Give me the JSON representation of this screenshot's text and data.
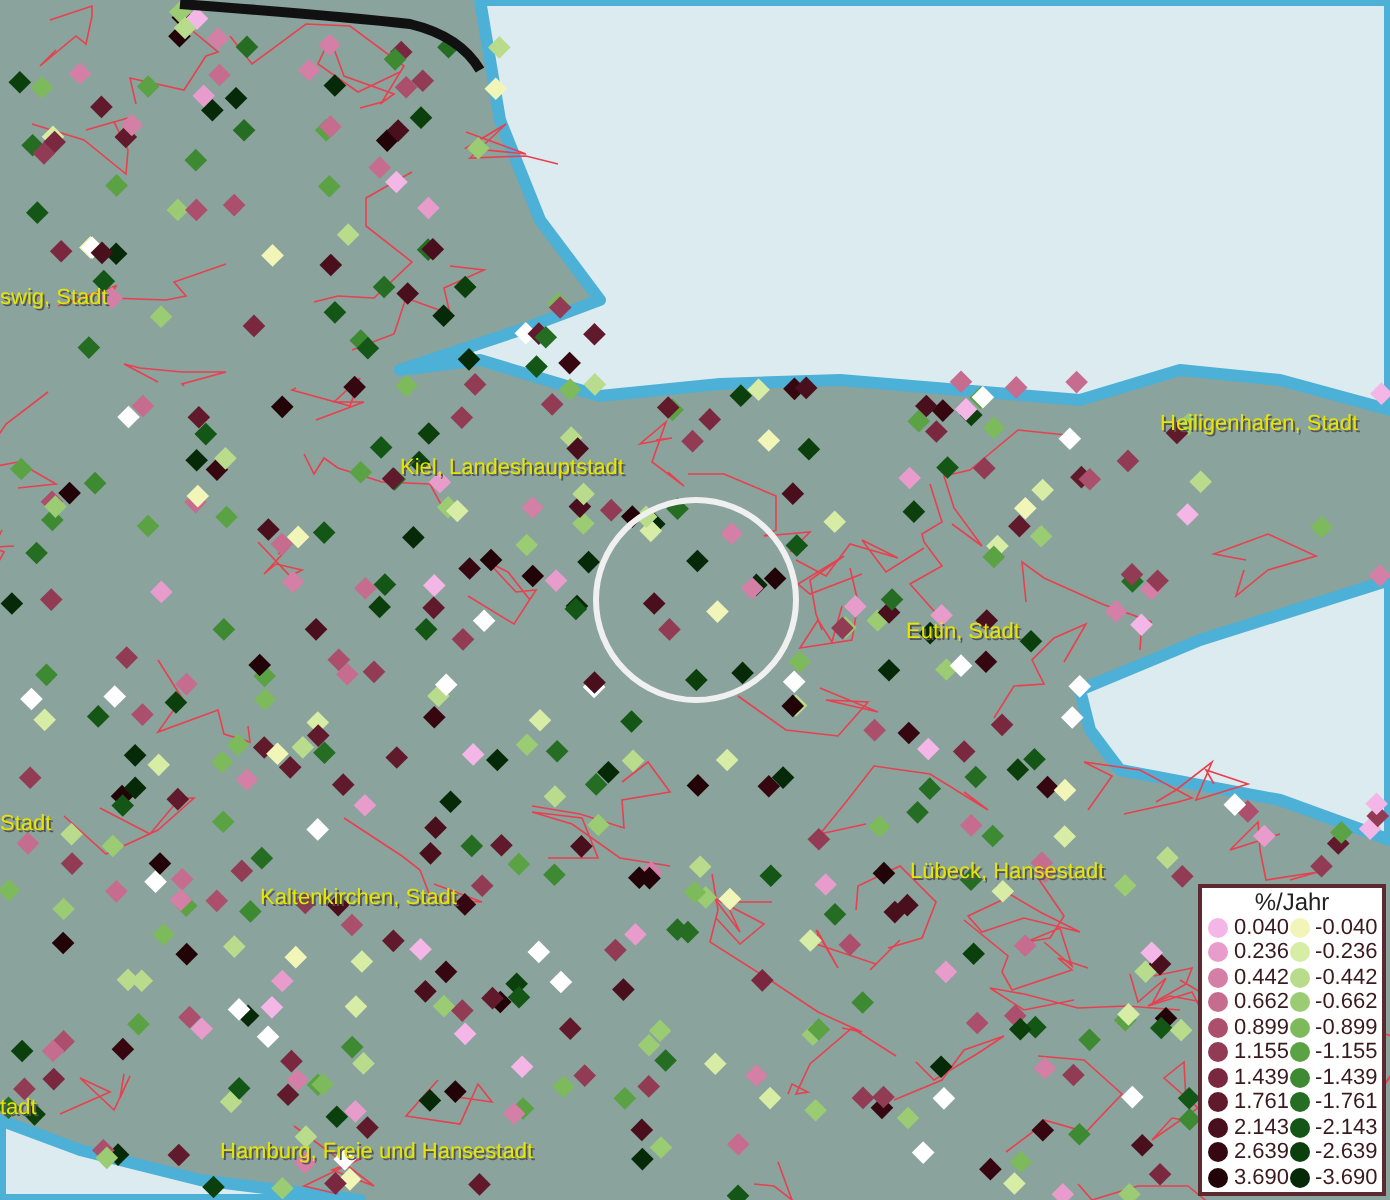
{
  "map_labels": [
    {
      "text": "swig, Stadt"
    },
    {
      "text": "Kiel, Landeshauptstadt"
    },
    {
      "text": "Heiligenhafen, Stadt"
    },
    {
      "text": "Eutin, Stadt"
    },
    {
      "text": "Stadt"
    },
    {
      "text": "Kaltenkirchen, Stadt"
    },
    {
      "text": "Lübeck, Hansestadt"
    },
    {
      "text": "tadt"
    },
    {
      "text": "Hamburg, Freie und Hansestadt"
    }
  ],
  "legend": {
    "title": "%/Jahr",
    "rows": [
      {
        "positive": {
          "value": "0.040",
          "color": "#f4b6e6"
        },
        "negative": {
          "value": "-0.040",
          "color": "#f2f5b8"
        }
      },
      {
        "positive": {
          "value": "0.236",
          "color": "#e79ccc"
        },
        "negative": {
          "value": "-0.236",
          "color": "#d7eca4"
        }
      },
      {
        "positive": {
          "value": "0.442",
          "color": "#d47fa6"
        },
        "negative": {
          "value": "-0.442",
          "color": "#b9dc8c"
        }
      },
      {
        "positive": {
          "value": "0.662",
          "color": "#c66c8e"
        },
        "negative": {
          "value": "-0.662",
          "color": "#9bcb73"
        }
      },
      {
        "positive": {
          "value": "0.899",
          "color": "#ac4f6c"
        },
        "negative": {
          "value": "-0.899",
          "color": "#7dba5b"
        }
      },
      {
        "positive": {
          "value": "1.155",
          "color": "#923b55"
        },
        "negative": {
          "value": "-1.155",
          "color": "#5aa243"
        }
      },
      {
        "positive": {
          "value": "1.439",
          "color": "#7a2840"
        },
        "negative": {
          "value": "-1.439",
          "color": "#3d8a33"
        }
      },
      {
        "positive": {
          "value": "1.761",
          "color": "#601a2b"
        },
        "negative": {
          "value": "-1.761",
          "color": "#256d22"
        }
      },
      {
        "positive": {
          "value": "2.143",
          "color": "#4a0f1c"
        },
        "negative": {
          "value": "-2.143",
          "color": "#145616"
        }
      },
      {
        "positive": {
          "value": "2.639",
          "color": "#360711"
        },
        "negative": {
          "value": "-2.639",
          "color": "#0b400d"
        }
      },
      {
        "positive": {
          "value": "3.690",
          "color": "#220308"
        },
        "negative": {
          "value": "-3.690",
          "color": "#062a07"
        }
      }
    ]
  }
}
